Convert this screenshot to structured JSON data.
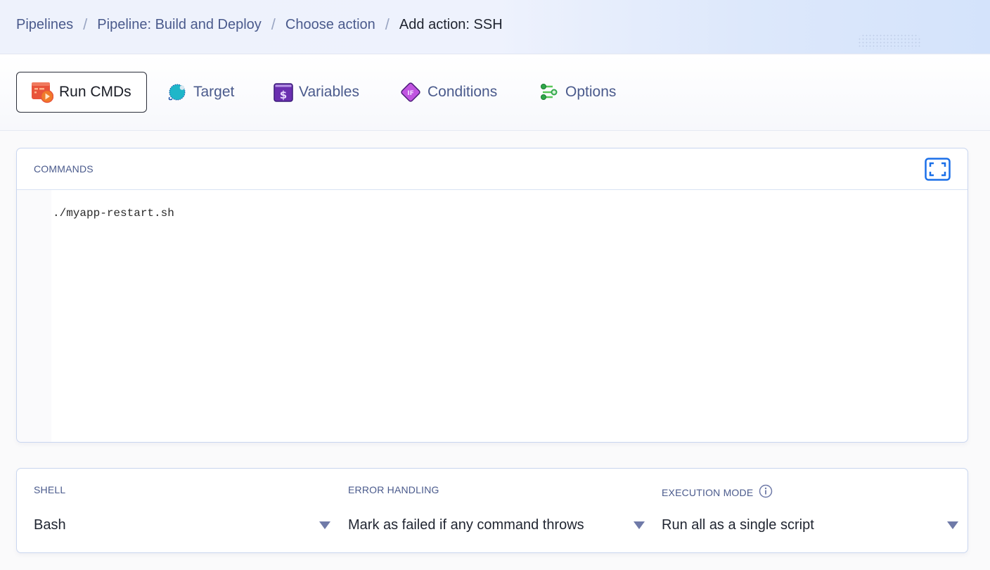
{
  "breadcrumb": {
    "items": [
      {
        "label": "Pipelines"
      },
      {
        "label": "Pipeline: Build and Deploy"
      },
      {
        "label": "Choose action"
      }
    ],
    "current": "Add action: SSH",
    "separator": "/"
  },
  "tabs": [
    {
      "label": "Run CMDs",
      "icon": "run-cmds-icon",
      "active": true
    },
    {
      "label": "Target",
      "icon": "planet-icon",
      "active": false
    },
    {
      "label": "Variables",
      "icon": "dollar-variable-icon",
      "active": false
    },
    {
      "label": "Conditions",
      "icon": "if-diamond-icon",
      "active": false
    },
    {
      "label": "Options",
      "icon": "sliders-icon",
      "active": false
    }
  ],
  "commands": {
    "label": "COMMANDS",
    "code": "./myapp-restart.sh",
    "expand_icon": "fullscreen-expand-icon"
  },
  "settings": {
    "shell": {
      "label": "SHELL",
      "value": "Bash"
    },
    "error_handling": {
      "label": "ERROR HANDLING",
      "value": "Mark as failed if any command throws"
    },
    "execution_mode": {
      "label": "EXECUTION MODE",
      "value": "Run all as a single script",
      "info_icon": "info-icon"
    }
  },
  "colors": {
    "accent_blue": "#1a6fe8",
    "link_text": "#4a5a8c",
    "run_cmds_icon": "#e8533a",
    "target_icon": "#1fb6c9",
    "variables_icon": "#6a2fb0",
    "conditions_icon": "#c054e0",
    "options_icon": "#2fa84a"
  }
}
